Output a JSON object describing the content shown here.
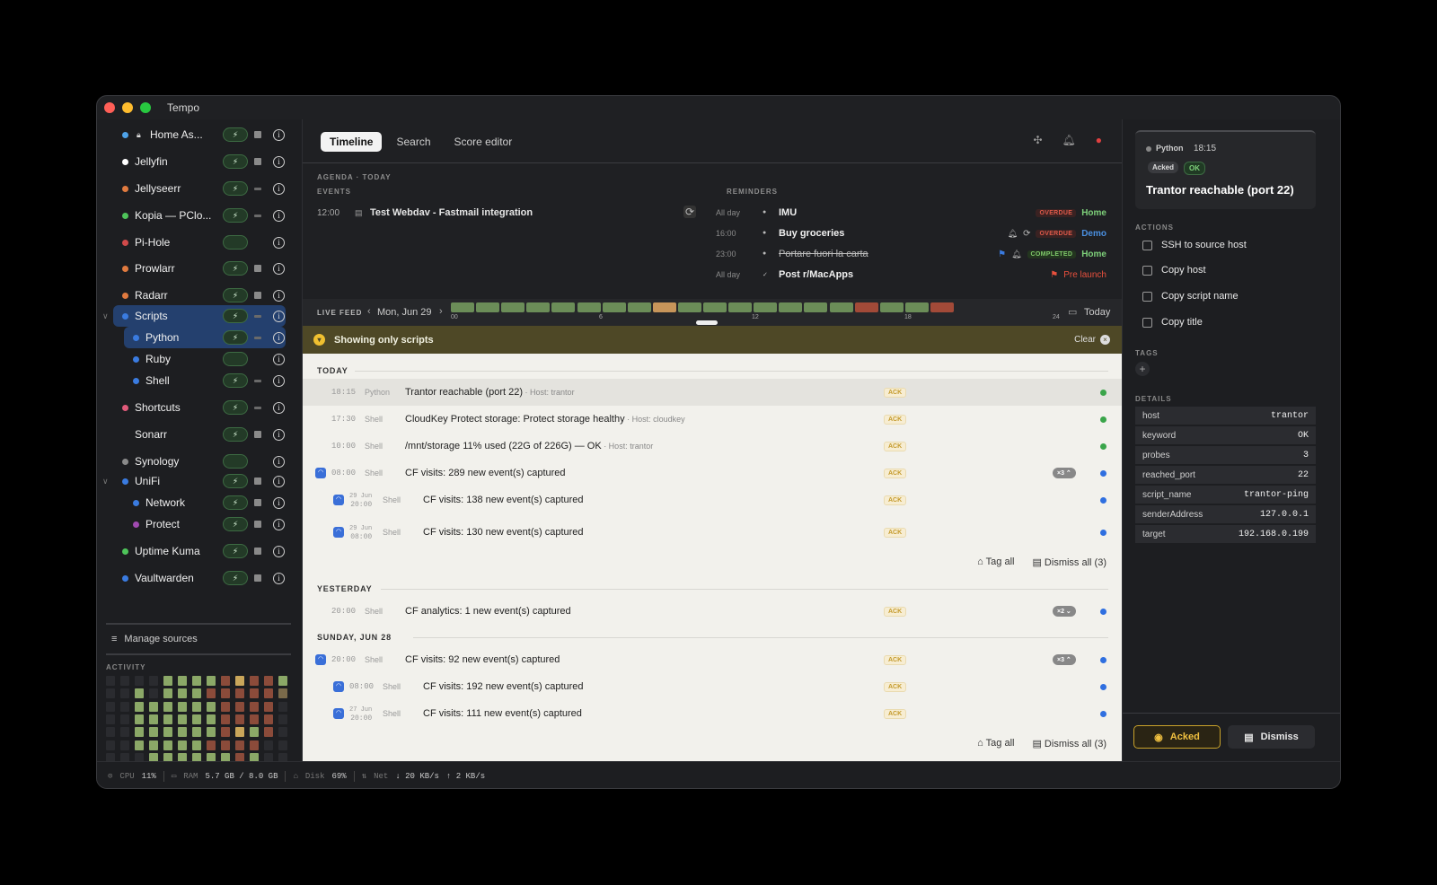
{
  "app": {
    "title": "Tempo",
    "lights": [
      "#ff5f57",
      "#febc2e",
      "#28c840"
    ]
  },
  "sidebar": {
    "sources": [
      {
        "label": "Home As...",
        "color": "#4ea2e8",
        "lock": true,
        "bolt": true,
        "stop": "full"
      },
      {
        "label": "Jellyfin",
        "color": "#ffffff",
        "bolt": true,
        "stop": "full"
      },
      {
        "label": "Jellyseerr",
        "color": "#e07a3f",
        "bolt": true,
        "stop": "dim"
      },
      {
        "label": "Kopia — PClo...",
        "color": "#4ec45a",
        "bolt": true,
        "stop": "dim"
      },
      {
        "label": "Pi-Hole",
        "color": "#d04a4a",
        "bolt": false,
        "stop": "none"
      },
      {
        "label": "Prowlarr",
        "color": "#e07a3f",
        "bolt": true,
        "stop": "full"
      },
      {
        "label": "Radarr",
        "color": "#e07a3f",
        "bolt": true,
        "stop": "full"
      },
      {
        "label": "Scripts",
        "color": "#3a7be0",
        "bolt": true,
        "stop": "dim",
        "chev": "∨",
        "selected": true
      },
      {
        "label": "Python",
        "color": "#3a7be0",
        "bolt": true,
        "stop": "dim",
        "child": true,
        "selected": true
      },
      {
        "label": "Ruby",
        "color": "#3a7be0",
        "bolt": false,
        "stop": "none",
        "child": true
      },
      {
        "label": "Shell",
        "color": "#3a7be0",
        "bolt": true,
        "stop": "dim",
        "child": true
      },
      {
        "label": "Shortcuts",
        "color": "#e05a7a",
        "bolt": true,
        "stop": "dim"
      },
      {
        "label": "Sonarr",
        "color": "",
        "bolt": true,
        "stop": "full"
      },
      {
        "label": "Synology",
        "color": "#8a8a8a",
        "bolt": false,
        "stop": "none"
      },
      {
        "label": "UniFi",
        "color": "#3a7be0",
        "bolt": true,
        "stop": "full",
        "chev": "∨"
      },
      {
        "label": "Network",
        "color": "#3a7be0",
        "bolt": true,
        "stop": "full",
        "child": true
      },
      {
        "label": "Protect",
        "color": "#a04ab0",
        "bolt": true,
        "stop": "full",
        "child": true
      },
      {
        "label": "Uptime Kuma",
        "color": "#4ec45a",
        "bolt": true,
        "stop": "full"
      },
      {
        "label": "Vaultwarden",
        "color": "#3a7be0",
        "bolt": true,
        "stop": "full"
      }
    ],
    "manage_label": "Manage sources",
    "activity_label": "ACTIVITY",
    "activity_grid": [
      [
        "e",
        "e",
        "e",
        "e",
        "e",
        "e",
        "e"
      ],
      [
        "e",
        "e",
        "e",
        "e",
        "e",
        "e",
        "e"
      ],
      [
        "e",
        "g",
        "g",
        "g",
        "g",
        "g",
        "e"
      ],
      [
        "e",
        "e",
        "g",
        "g",
        "g",
        "g",
        "g"
      ],
      [
        "g",
        "g",
        "g",
        "g",
        "g",
        "g",
        "g"
      ],
      [
        "g",
        "g",
        "g",
        "g",
        "g",
        "g",
        "g"
      ],
      [
        "g",
        "g",
        "g",
        "g",
        "g",
        "g",
        "g"
      ],
      [
        "g",
        "r",
        "g",
        "g",
        "g",
        "r",
        "g"
      ],
      [
        "r",
        "r",
        "r",
        "r",
        "r",
        "r",
        "g"
      ],
      [
        "y",
        "r",
        "r",
        "r",
        "y",
        "r",
        "r"
      ],
      [
        "r",
        "r",
        "r",
        "r",
        "g",
        "r",
        "g"
      ],
      [
        "r",
        "r",
        "r",
        "r",
        "r",
        "e",
        "e"
      ],
      [
        "g",
        "t",
        "e",
        "e",
        "e",
        "e",
        "e"
      ]
    ]
  },
  "toolbar": {
    "tabs": [
      "Timeline",
      "Search",
      "Score editor"
    ]
  },
  "agenda": {
    "title": "AGENDA · TODAY",
    "events_label": "EVENTS",
    "reminders_label": "REMINDERS",
    "events": [
      {
        "time": "12:00",
        "title": "Test Webdav - Fastmail integration"
      }
    ],
    "reminders": [
      {
        "time": "All day",
        "title": "IMU",
        "badge": "OVERDUE",
        "tag": "Home",
        "tagclass": "tag-home"
      },
      {
        "time": "16:00",
        "title": "Buy groceries",
        "badge": "OVERDUE",
        "tag": "Demo",
        "tagclass": "tag-demo",
        "bell": true,
        "repeat": true
      },
      {
        "time": "23:00",
        "title": "Portare fuori la carta",
        "badge": "COMPLETED",
        "tag": "Home",
        "tagclass": "tag-home",
        "strike": true,
        "flag": true,
        "bell": true
      },
      {
        "time": "All day",
        "title": "Post r/MacApps",
        "tag": "Pre launch",
        "tagclass": "tag-pre",
        "flag": true
      }
    ]
  },
  "livefeed": {
    "label": "LIVE FEED",
    "date": "Mon, Jun 29",
    "today_label": "Today",
    "ticks": [
      "00",
      "6",
      "12",
      "18",
      "24"
    ],
    "segments": [
      "g",
      "g",
      "g",
      "g",
      "g",
      "g",
      "g",
      "g",
      "y",
      "g",
      "g",
      "g",
      "g",
      "g",
      "g",
      "g",
      "r",
      "g",
      "g",
      "r"
    ]
  },
  "banner": {
    "text": "Showing only scripts",
    "clear": "Clear"
  },
  "feed": {
    "sections": [
      {
        "label": "TODAY"
      },
      {
        "label": "YESTERDAY"
      },
      {
        "label": "SUNDAY, JUN 28"
      }
    ],
    "rows": [
      {
        "time": "18:15",
        "source": "Python",
        "title": "Trantor reachable (port 22)",
        "host": "Host: trantor",
        "ack": "ACK",
        "dot": "#3aa54a",
        "hl": true
      },
      {
        "time": "17:30",
        "source": "Shell",
        "title": "CloudKey Protect storage: Protect storage healthy",
        "host": "Host: cloudkey",
        "ack": "ACK",
        "dot": "#3aa54a"
      },
      {
        "time": "10:00",
        "source": "Shell",
        "title": "/mnt/storage 11% used (22G of 226G) — OK",
        "host": "Host: trantor",
        "ack": "ACK",
        "dot": "#3aa54a"
      },
      {
        "time": "08:00",
        "source": "Shell",
        "title": "CF visits: 289 new event(s) captured",
        "ack": "ACK",
        "dot": "#2f6fe0",
        "wifi": true,
        "count": "×3 ⌃"
      },
      {
        "time": "20:00",
        "date": "29 Jun",
        "source": "Shell",
        "title": "CF visits: 138 new event(s) captured",
        "ack": "ACK",
        "dot": "#2f6fe0",
        "wifi": true,
        "child": true
      },
      {
        "time": "08:00",
        "date": "29 Jun",
        "source": "Shell",
        "title": "CF visits: 130 new event(s) captured",
        "ack": "ACK",
        "dot": "#2f6fe0",
        "wifi": true,
        "child": true
      },
      {
        "time": "20:00",
        "source": "Shell",
        "title": "CF analytics: 1 new event(s) captured",
        "ack": "ACK",
        "dot": "#2f6fe0",
        "count": "×2 ⌄"
      },
      {
        "time": "20:00",
        "source": "Shell",
        "title": "CF visits: 92 new event(s) captured",
        "ack": "ACK",
        "dot": "#2f6fe0",
        "wifi": true,
        "count": "×3 ⌃"
      },
      {
        "time": "08:00",
        "source": "Shell",
        "title": "CF visits: 192 new event(s) captured",
        "ack": "ACK",
        "dot": "#2f6fe0",
        "wifi": true,
        "child": true
      },
      {
        "time": "20:00",
        "date": "27 Jun",
        "source": "Shell",
        "title": "CF visits: 111 new event(s) captured",
        "ack": "ACK",
        "dot": "#2f6fe0",
        "wifi": true,
        "child": true
      }
    ],
    "tag_all": "Tag all",
    "dismiss_all": "Dismiss all (3)"
  },
  "status": {
    "cpu_label": "CPU",
    "cpu": "11%",
    "ram_label": "RAM",
    "ram": "5.7 GB / 8.0 GB",
    "disk_label": "Disk",
    "disk": "69%",
    "net_label": "Net",
    "down": "↓ 20 KB/s",
    "up": "↑ 2 KB/s"
  },
  "detail": {
    "source": "Python",
    "time": "18:15",
    "badges": [
      "Acked",
      "OK"
    ],
    "title": "Trantor reachable (port 22)",
    "actions_label": "ACTIONS",
    "actions": [
      "SSH to source host",
      "Copy host",
      "Copy script name",
      "Copy title"
    ],
    "tags_label": "TAGS",
    "details_label": "DETAILS",
    "details": [
      {
        "k": "host",
        "v": "trantor"
      },
      {
        "k": "keyword",
        "v": "OK"
      },
      {
        "k": "probes",
        "v": "3"
      },
      {
        "k": "reached_port",
        "v": "22"
      },
      {
        "k": "script_name",
        "v": "trantor-ping"
      },
      {
        "k": "senderAddress",
        "v": "127.0.0.1"
      },
      {
        "k": "target",
        "v": "192.168.0.199"
      }
    ],
    "acked_btn": "Acked",
    "dismiss_btn": "Dismiss"
  }
}
